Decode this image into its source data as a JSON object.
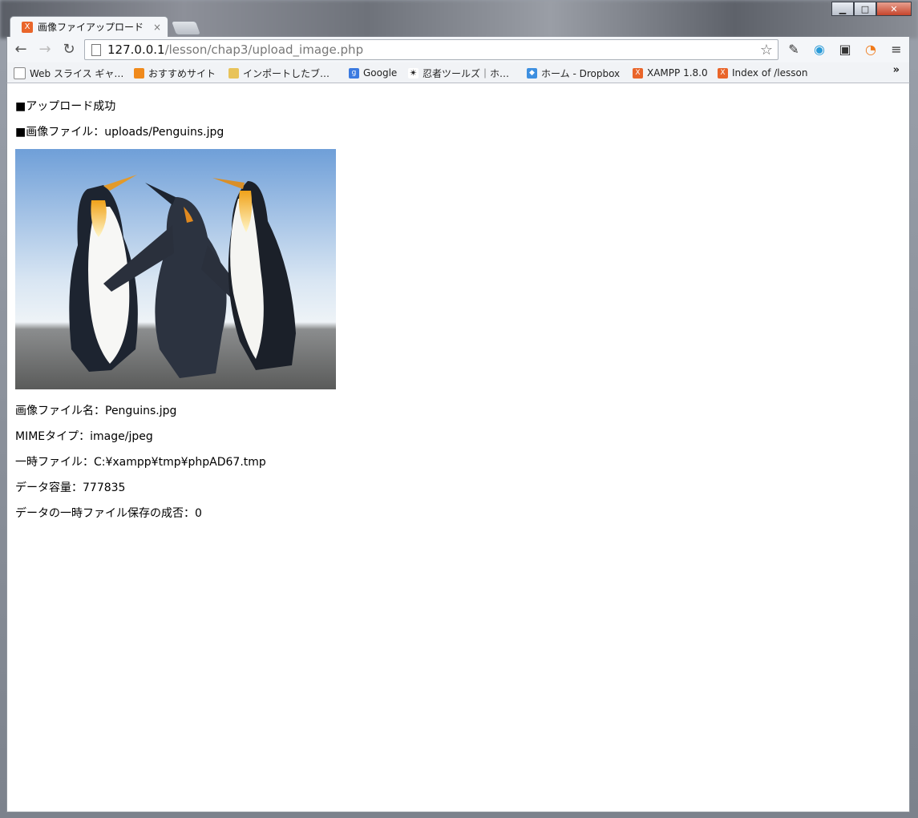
{
  "browser": {
    "tab_title": "画像ファイアップロード",
    "tab_close": "×",
    "url_host": "127.0.0.1",
    "url_path": "/lesson/chap3/upload_image.php",
    "favicon_label": "X",
    "window_buttons": {
      "minimize": "▁",
      "maximize": "□",
      "close": "✕"
    }
  },
  "bookmarks": [
    {
      "label": "Web スライス ギャ…",
      "icon": "page-icon",
      "color": "#ffffff"
    },
    {
      "label": "おすすめサイト",
      "icon": "bulb-icon",
      "color": "#f08a1c"
    },
    {
      "label": "インポートしたブ…",
      "icon": "folder-icon",
      "color": "#e8c35a"
    },
    {
      "label": "Google",
      "icon": "google-icon",
      "color": "#3b7ae0"
    },
    {
      "label": "忍者ツールズ｜ホ…",
      "icon": "ninja-icon",
      "color": "#222222"
    },
    {
      "label": "ホーム - Dropbox",
      "icon": "dropbox-icon",
      "color": "#3d8fe0"
    },
    {
      "label": "XAMPP 1.8.0",
      "icon": "xampp-icon",
      "color": "#e9652a"
    },
    {
      "label": "Index of /lesson",
      "icon": "xampp-icon",
      "color": "#e9652a"
    }
  ],
  "bookmarks_more": "»",
  "page": {
    "status_line": "■アップロード成功",
    "image_file_line": "■画像ファイル：uploads/Penguins.jpg",
    "file_name_line": "画像ファイル名：Penguins.jpg",
    "mime_line": "MIMEタイプ：image/jpeg",
    "tmp_line": "一時ファイル：C:¥xampp¥tmp¥phpAD67.tmp",
    "size_line": "データ容量：777835",
    "error_line": "データの一時ファイル保存の成否：0"
  }
}
